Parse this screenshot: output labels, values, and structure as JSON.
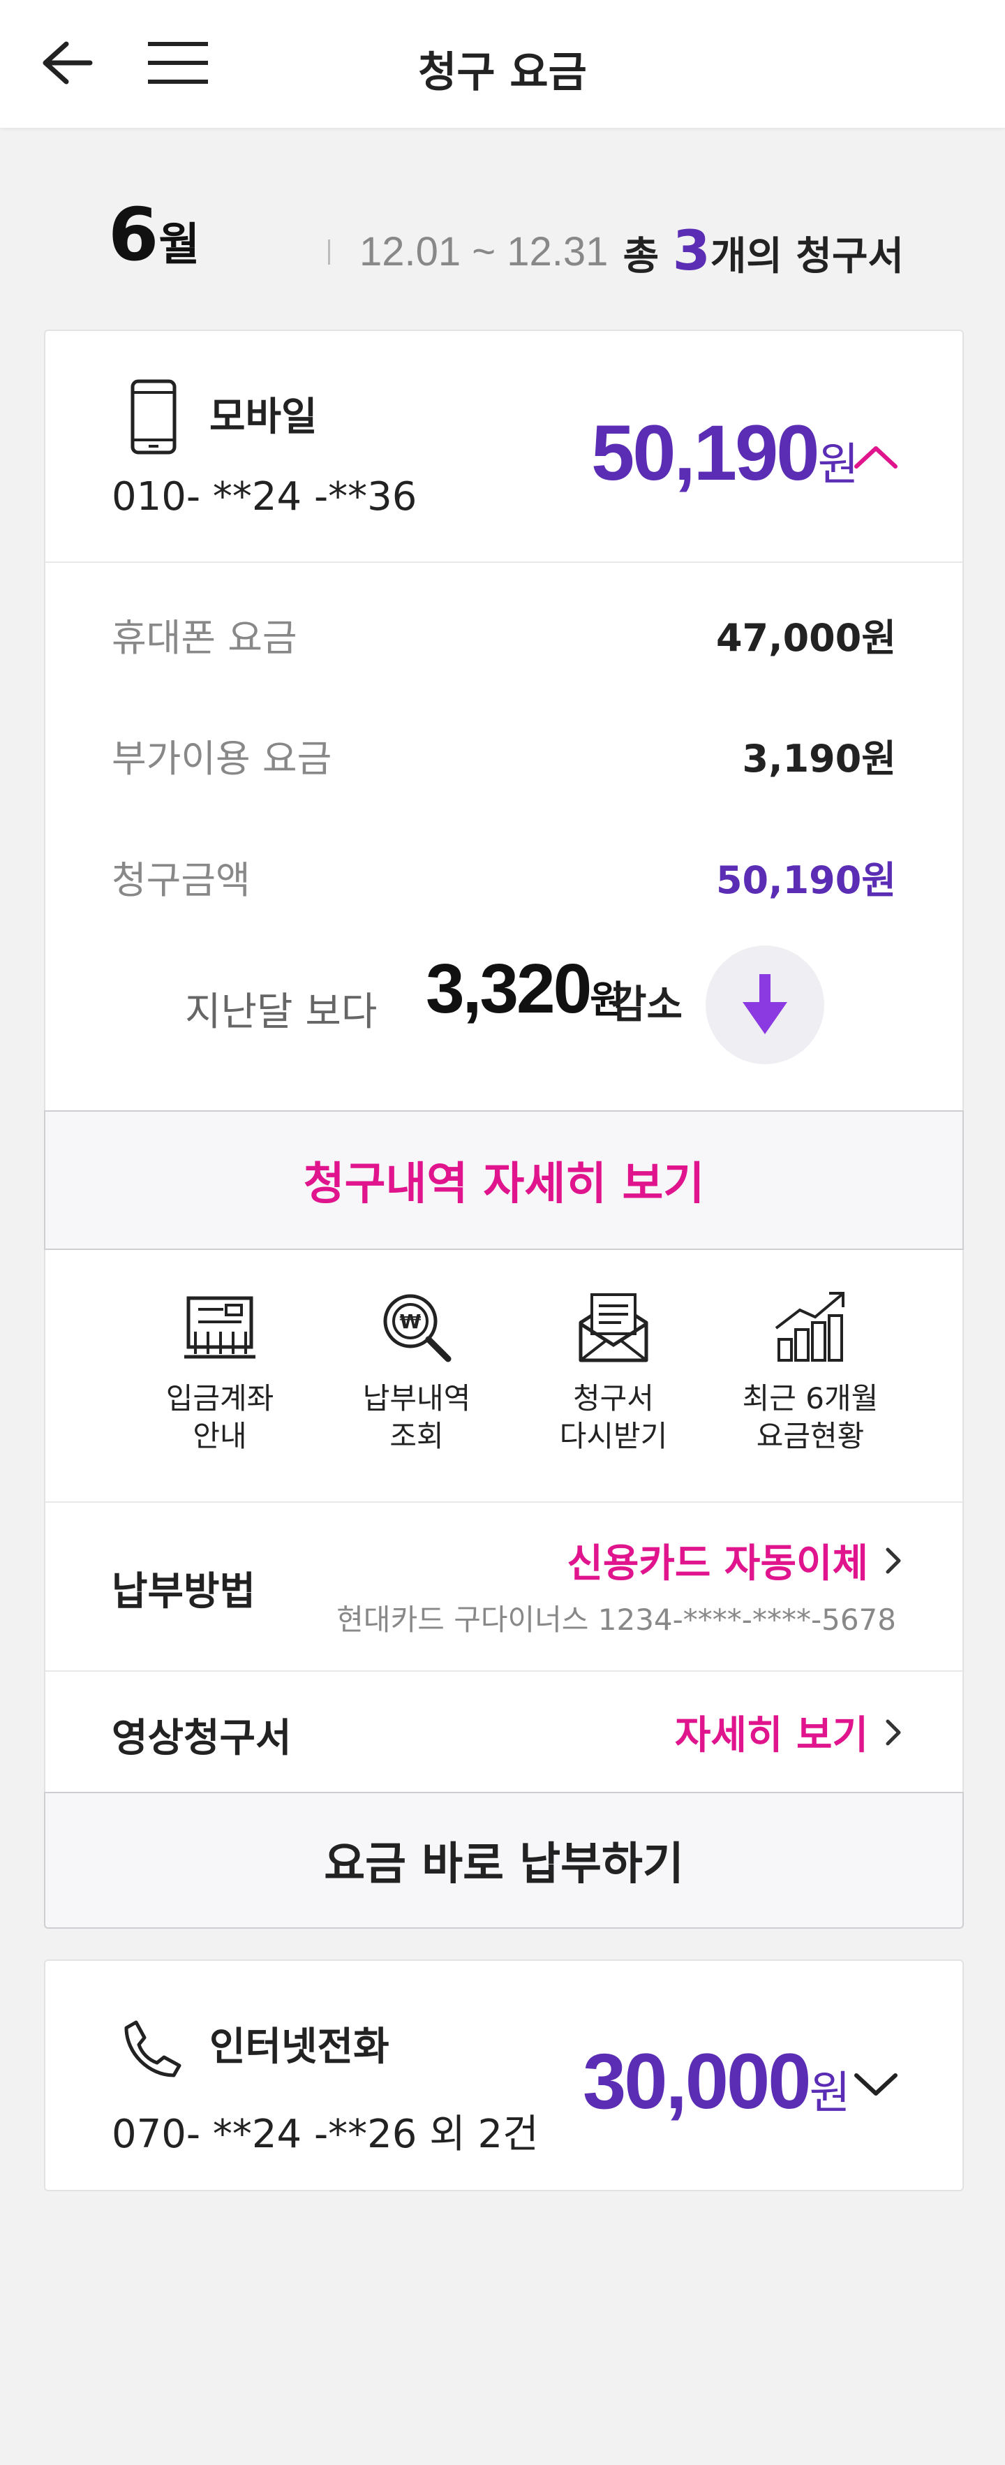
{
  "header": {
    "title": "청구 요금",
    "back_icon": "back-arrow-icon",
    "menu_icon": "hamburger-menu-icon"
  },
  "period": {
    "month": "6",
    "month_unit": "월",
    "range": "12.01 ~ 12.31",
    "total_prefix": "총 ",
    "total_count": "3",
    "total_suffix": "개의 청구서"
  },
  "mobile": {
    "icon": "smartphone-icon",
    "name": "모바일",
    "number": "010- **24 -**36",
    "amount": "50,190",
    "amount_unit": "원",
    "expanded": true,
    "rows": [
      {
        "label": "휴대폰 요금",
        "value": "47,000원"
      },
      {
        "label": "부가이용 요금",
        "value": "3,190원"
      },
      {
        "label": "청구금액",
        "value": "50,190원"
      }
    ],
    "compare": {
      "label": "지난달 보다",
      "amount": "3,320",
      "unit": "원",
      "state": "감소",
      "icon": "arrow-down-icon"
    },
    "detail_button": "청구내역 자세히 보기",
    "quick_menu": [
      {
        "icon": "bank-account-icon",
        "label": "입금계좌\n안내"
      },
      {
        "icon": "payment-history-search-icon",
        "label": "납부내역\n조회"
      },
      {
        "icon": "bill-envelope-icon",
        "label": "청구서\n다시받기"
      },
      {
        "icon": "bar-chart-icon",
        "label": "최근 6개월\n요금현황"
      }
    ],
    "payment_method": {
      "label": "납부방법",
      "value": "신용카드 자동이체",
      "sub": "현대카드 구다이너스 1234-****-****-5678"
    },
    "video_bill": {
      "label": "영상청구서",
      "link": "자세히 보기"
    },
    "pay_button": "요금 바로 납부하기"
  },
  "internet_phone": {
    "icon": "phone-handset-icon",
    "name": "인터넷전화",
    "number": "070- **24 -**26 외 2건",
    "amount": "30,000",
    "amount_unit": "원",
    "expanded": false
  },
  "colors": {
    "accent_purple": "#5a2db4",
    "accent_pink": "#e0148c",
    "arrow_purple": "#8a3ae0"
  }
}
